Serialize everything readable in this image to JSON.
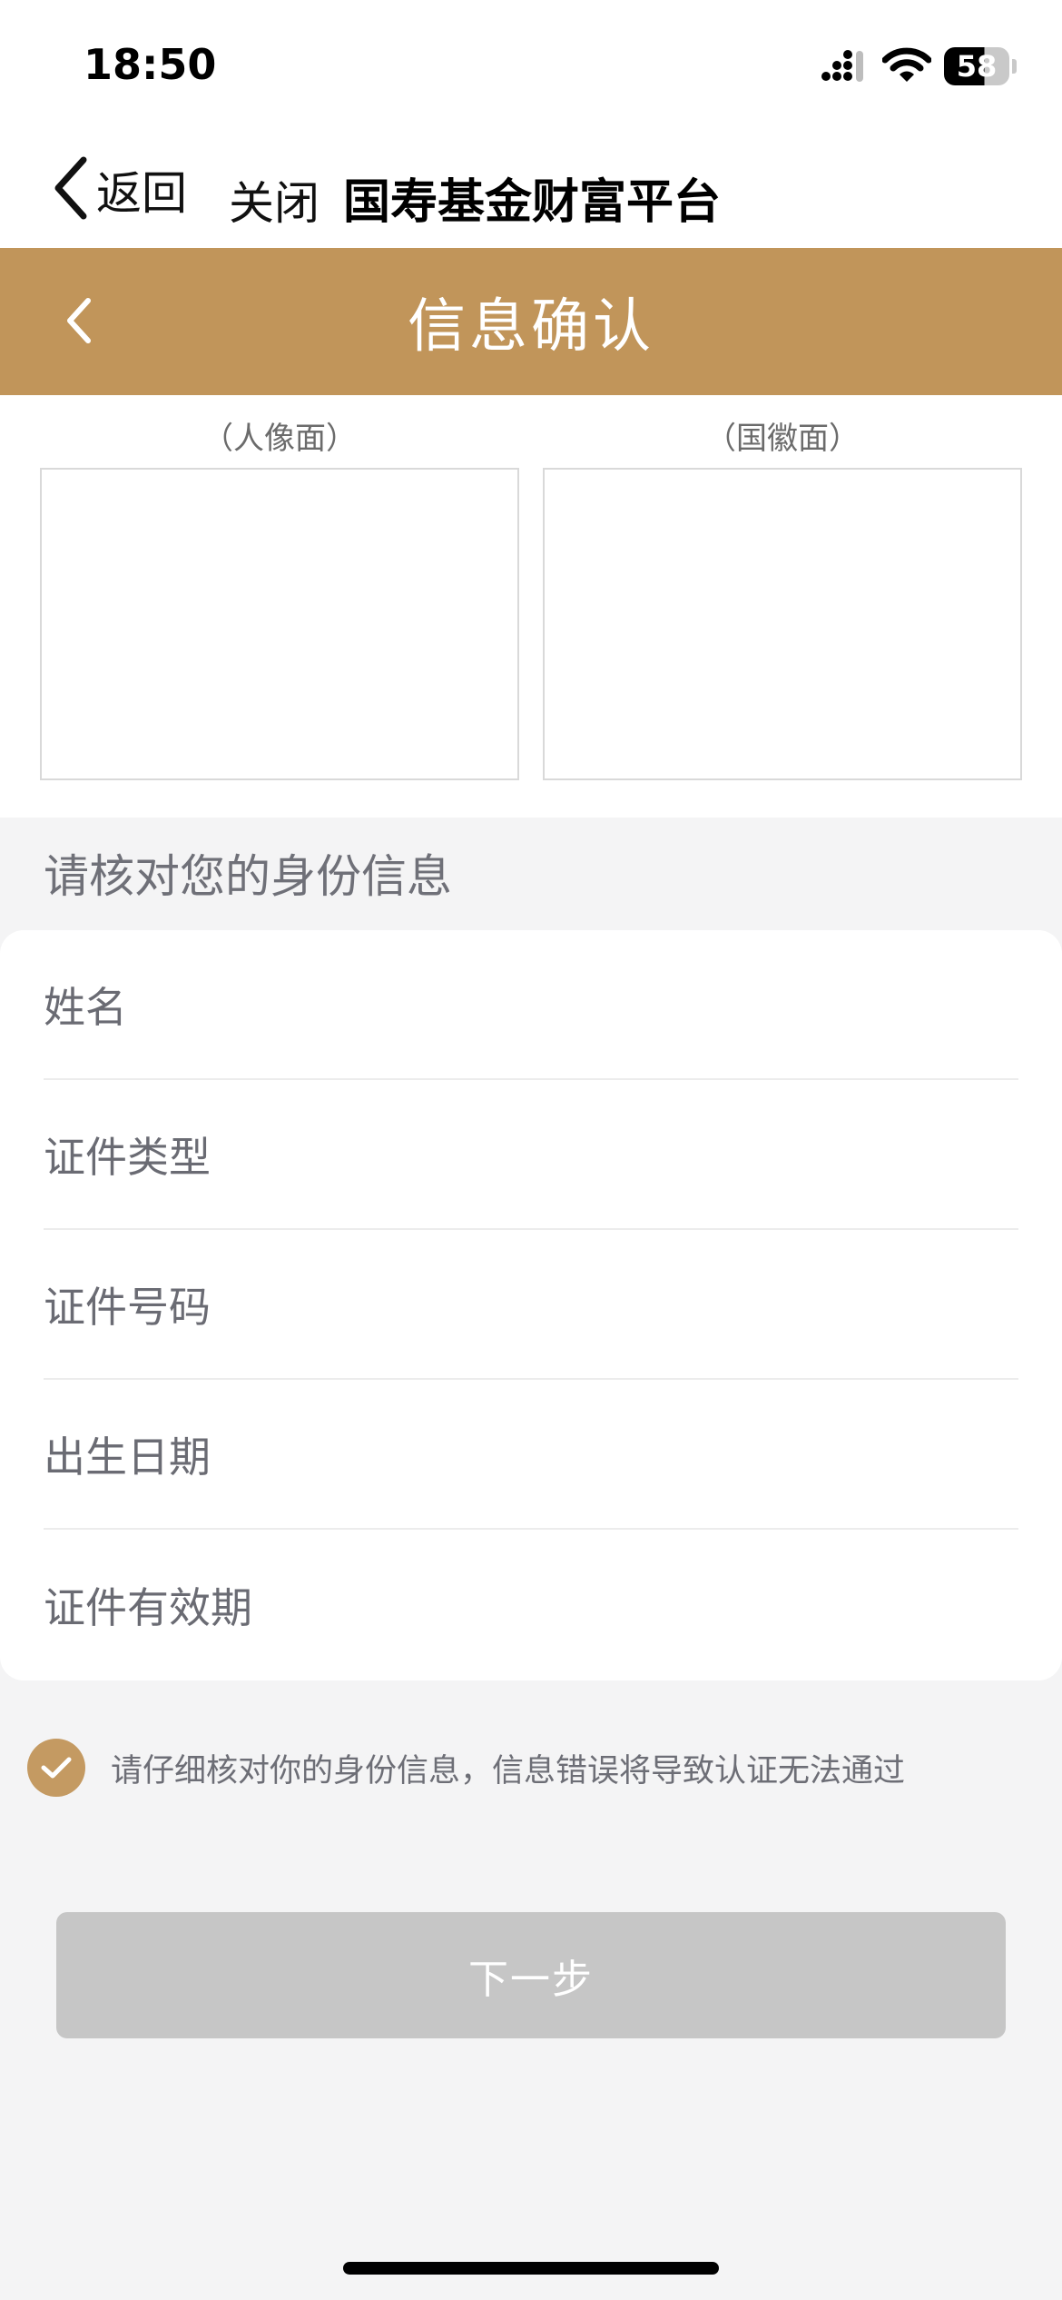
{
  "status_bar": {
    "time": "18:50",
    "battery": "58",
    "icons": [
      "signal-icon",
      "wifi-icon",
      "battery-icon"
    ]
  },
  "nav": {
    "back_label": "返回",
    "close_label": "关闭",
    "title": "国寿基金财富平台"
  },
  "header": {
    "title": "信息确认",
    "back_icon": "chevron-left-icon",
    "background": "#c1955a"
  },
  "id_photos": {
    "front_caption": "（人像面）",
    "back_caption": "（国徽面）"
  },
  "section": {
    "title": "请核对您的身份信息"
  },
  "form": {
    "fields": [
      {
        "label": "姓名"
      },
      {
        "label": "证件类型"
      },
      {
        "label": "证件号码"
      },
      {
        "label": "出生日期"
      },
      {
        "label": "证件有效期"
      }
    ]
  },
  "agreement": {
    "text": "请仔细核对你的身份信息，信息错误将导致认证无法通过",
    "checked": true,
    "accent": "#c49a62"
  },
  "actions": {
    "next_label": "下一步",
    "next_disabled": true
  }
}
